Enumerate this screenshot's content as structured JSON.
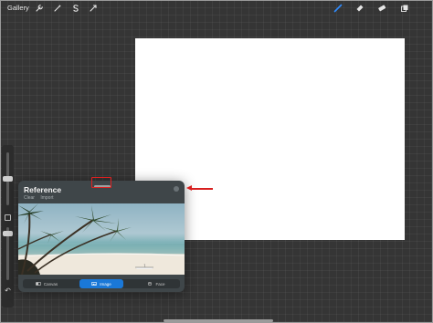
{
  "topbar": {
    "gallery_label": "Gallery",
    "left_tools": [
      "wrench-icon",
      "magic-wand-icon",
      "selection-icon",
      "transform-icon"
    ],
    "right_tools": [
      "brush-icon",
      "smudge-icon",
      "eraser-icon",
      "layers-icon"
    ],
    "accent_color": "#2f8cff"
  },
  "sidebar": {
    "size_slider_level": 0.5,
    "opacity_slider_level": 0.9,
    "icons": [
      "modify-button",
      "undo-icon"
    ]
  },
  "reference": {
    "title": "Reference",
    "actions": [
      "Clear",
      "Import"
    ],
    "tabs": [
      {
        "label": "Canvas",
        "icon": "canvas-icon",
        "active": false
      },
      {
        "label": "Image",
        "icon": "image-icon",
        "active": true
      },
      {
        "label": "Face",
        "icon": "face-icon",
        "active": false
      }
    ]
  },
  "annotations": {
    "highlight_color": "#e02020"
  }
}
